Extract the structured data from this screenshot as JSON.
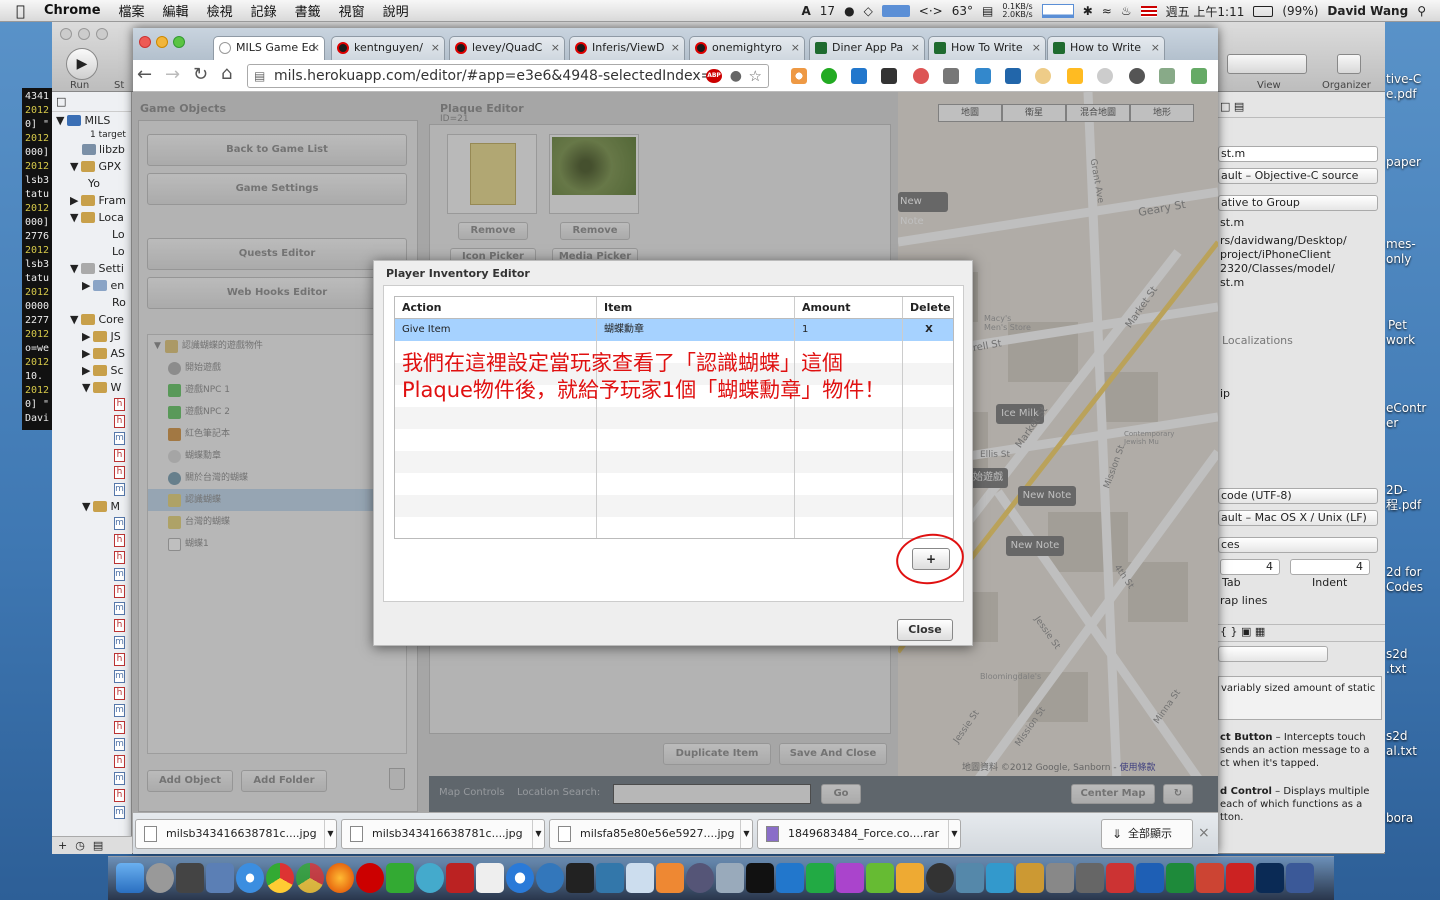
{
  "menubar": {
    "apple_icon": "apple-icon",
    "app": "Chrome",
    "items": [
      "檔案",
      "編輯",
      "檢視",
      "記錄",
      "書籤",
      "視窗",
      "說明"
    ],
    "status": {
      "adobe_count": "17",
      "temperature": "63°",
      "net_up": "0.1KB/s",
      "net_down": "2.0KB/s",
      "clock": "週五 上午1:11",
      "battery": "(99%)",
      "user": "David Wang"
    }
  },
  "terminal": {
    "lines": [
      "4341",
      "2012",
      "0] \"",
      "2012",
      "000]",
      "2012",
      "lsb3",
      "tatu",
      "2012",
      "000]",
      "2776",
      "2012",
      "lsb3",
      "tatu",
      "2012",
      "0000",
      "2277",
      "2012",
      "o=we",
      "2012",
      "10.",
      "2012",
      "0] \"",
      "Davi"
    ]
  },
  "xcode": {
    "toolbar": {
      "run": "Run",
      "stop": "St",
      "view": "View",
      "organizer": "Organizer"
    },
    "navigator": {
      "project": "MILS",
      "targets": "1 target",
      "rows": [
        "libzb",
        "GPX",
        "Yo",
        "Fram",
        "Loca",
        "Lo",
        "Lo",
        "Setti",
        "en",
        "Ro",
        "Core",
        "JS",
        "AS",
        "Sc",
        "W"
      ],
      "h_rows": [
        "h",
        "h",
        "m",
        "h",
        "h",
        "m"
      ],
      "m_group": "M",
      "m_rows": [
        "m",
        "h",
        "h",
        "m",
        "h",
        "m",
        "h",
        "m",
        "h",
        "m",
        "h",
        "m",
        "h",
        "m",
        "h",
        "m",
        "h",
        "m"
      ]
    },
    "inspector": {
      "filename": "st.m",
      "file_type": "ault – Objective-C source",
      "location": "ative to Group",
      "file2": "st.m",
      "path_lines": [
        "rs/davidwang/Desktop/",
        "project/iPhoneClient",
        " 2320/Classes/model/",
        "st.m"
      ],
      "localizations": "Localizations",
      "ip": "ip",
      "encoding": "code (UTF-8)",
      "line_endings": "ault – Mac OS X / Unix (LF)",
      "indent_using": "ces",
      "tab_width": "4",
      "indent_width": "4",
      "tab_label": "Tab",
      "indent_label": "Indent",
      "wrap": "rap lines",
      "desc1": "variably sized amount of static",
      "desc2_title": "ct Button",
      "desc2": " – Intercepts touch",
      "desc2b": " sends an action message to a",
      "desc2c": "ct when it's tapped.",
      "desc3_title": "d Control",
      "desc3": " – Displays multiple",
      "desc3b": "each of which functions as a",
      "desc3c": "tton."
    }
  },
  "desktop_files": [
    "tive-C",
    "e.pdf",
    "paper",
    "mes-",
    "only",
    "Pet",
    "work",
    "eContr",
    "er",
    "2D-",
    "程.pdf",
    "2d for",
    "Codes",
    "s2d",
    ".txt",
    "s2d",
    "al.txt",
    "bora"
  ],
  "chrome": {
    "tabs": [
      {
        "label": "MILS Game Ed",
        "active": true
      },
      {
        "label": "kentnguyen/"
      },
      {
        "label": "levey/QuadC"
      },
      {
        "label": "Inferis/ViewD"
      },
      {
        "label": "onemightyro"
      },
      {
        "label": "Diner App Pa"
      },
      {
        "label": "How To Write"
      },
      {
        "label": "How to Write"
      }
    ],
    "url": "mils.herokuapp.com/editor/#app=e3e6&4948-selectedIndex=0",
    "abp": "ABP"
  },
  "editor": {
    "game_objects_title": "Game Objects",
    "buttons": {
      "back": "Back to Game List",
      "settings": "Game Settings",
      "quests": "Quests Editor",
      "webhooks": "Web Hooks Editor",
      "add_object": "Add Object",
      "add_folder": "Add Folder"
    },
    "tree": [
      "認識蝴蝶的遊戲物件",
      "開始遊戲",
      "遊戲NPC 1",
      "遊戲NPC 2",
      "紅色筆記本",
      "蝴蝶勳章",
      "關於台灣的蝴蝶",
      "認識蝴蝶",
      "台灣的蝴蝶",
      "蝴蝶1"
    ],
    "plaque_title": "Plaque Editor",
    "plaque_sub": "ID=21",
    "remove1": "Remove",
    "remove2": "Remove",
    "icon_picker": "Icon Picker",
    "media_picker": "Media Picker",
    "duplicate": "Duplicate Item",
    "save_close": "Save And Close",
    "map_controls": "Map Controls",
    "location_search": "Location Search:",
    "go": "Go",
    "center_map": "Center Map",
    "map_tabs": [
      "地圖",
      "衛星",
      "混合地圖",
      "地形"
    ],
    "map_labels": [
      "New Note",
      "Ice Milk",
      "New Note",
      "New Note"
    ],
    "map_streets": [
      "Geary St",
      "Grant Ave",
      "Market St",
      "Farrell St",
      "Ellis St",
      "Market St",
      "Mission St",
      "4th St",
      "Jessie St",
      "Minna St",
      "Jessie St",
      "Mission St"
    ],
    "map_place": "Macy's Men's Store",
    "map_place2": "Contemporary Jewish Mu",
    "map_place3": "Bloomingdale's",
    "map_marker_text": "開始遊戲",
    "map_copyright": "地圖資料 ©2012 Google, Sanborn",
    "map_terms": "使用條款"
  },
  "dialog": {
    "title": "Player Inventory Editor",
    "columns": [
      "Action",
      "Item",
      "Amount",
      "Delete"
    ],
    "rows": [
      {
        "action": "Give Item",
        "item": "蝴蝶勳章",
        "amount": "1",
        "delete": "X"
      }
    ],
    "annotation_line1": "我們在這裡設定當玩家查看了「認識蝴蝶」這個",
    "annotation_line2": "Plaque物件後，就給予玩家1個「蝴蝶勳章」物件！",
    "add_button": "+",
    "close_button": "Close"
  },
  "downloads": {
    "items": [
      "milsb343416638781c....jpg",
      "milsb343416638781c....jpg",
      "milsfa85e80e56e5927....jpg",
      "1849683484_Force.co....rar"
    ],
    "show_all": "全部顯示",
    "close": "×"
  },
  "colors": {
    "selected_row": "#a6d2ff",
    "annotation": "#e01010",
    "overlay": "rgba(0,0,0,0.25)"
  }
}
